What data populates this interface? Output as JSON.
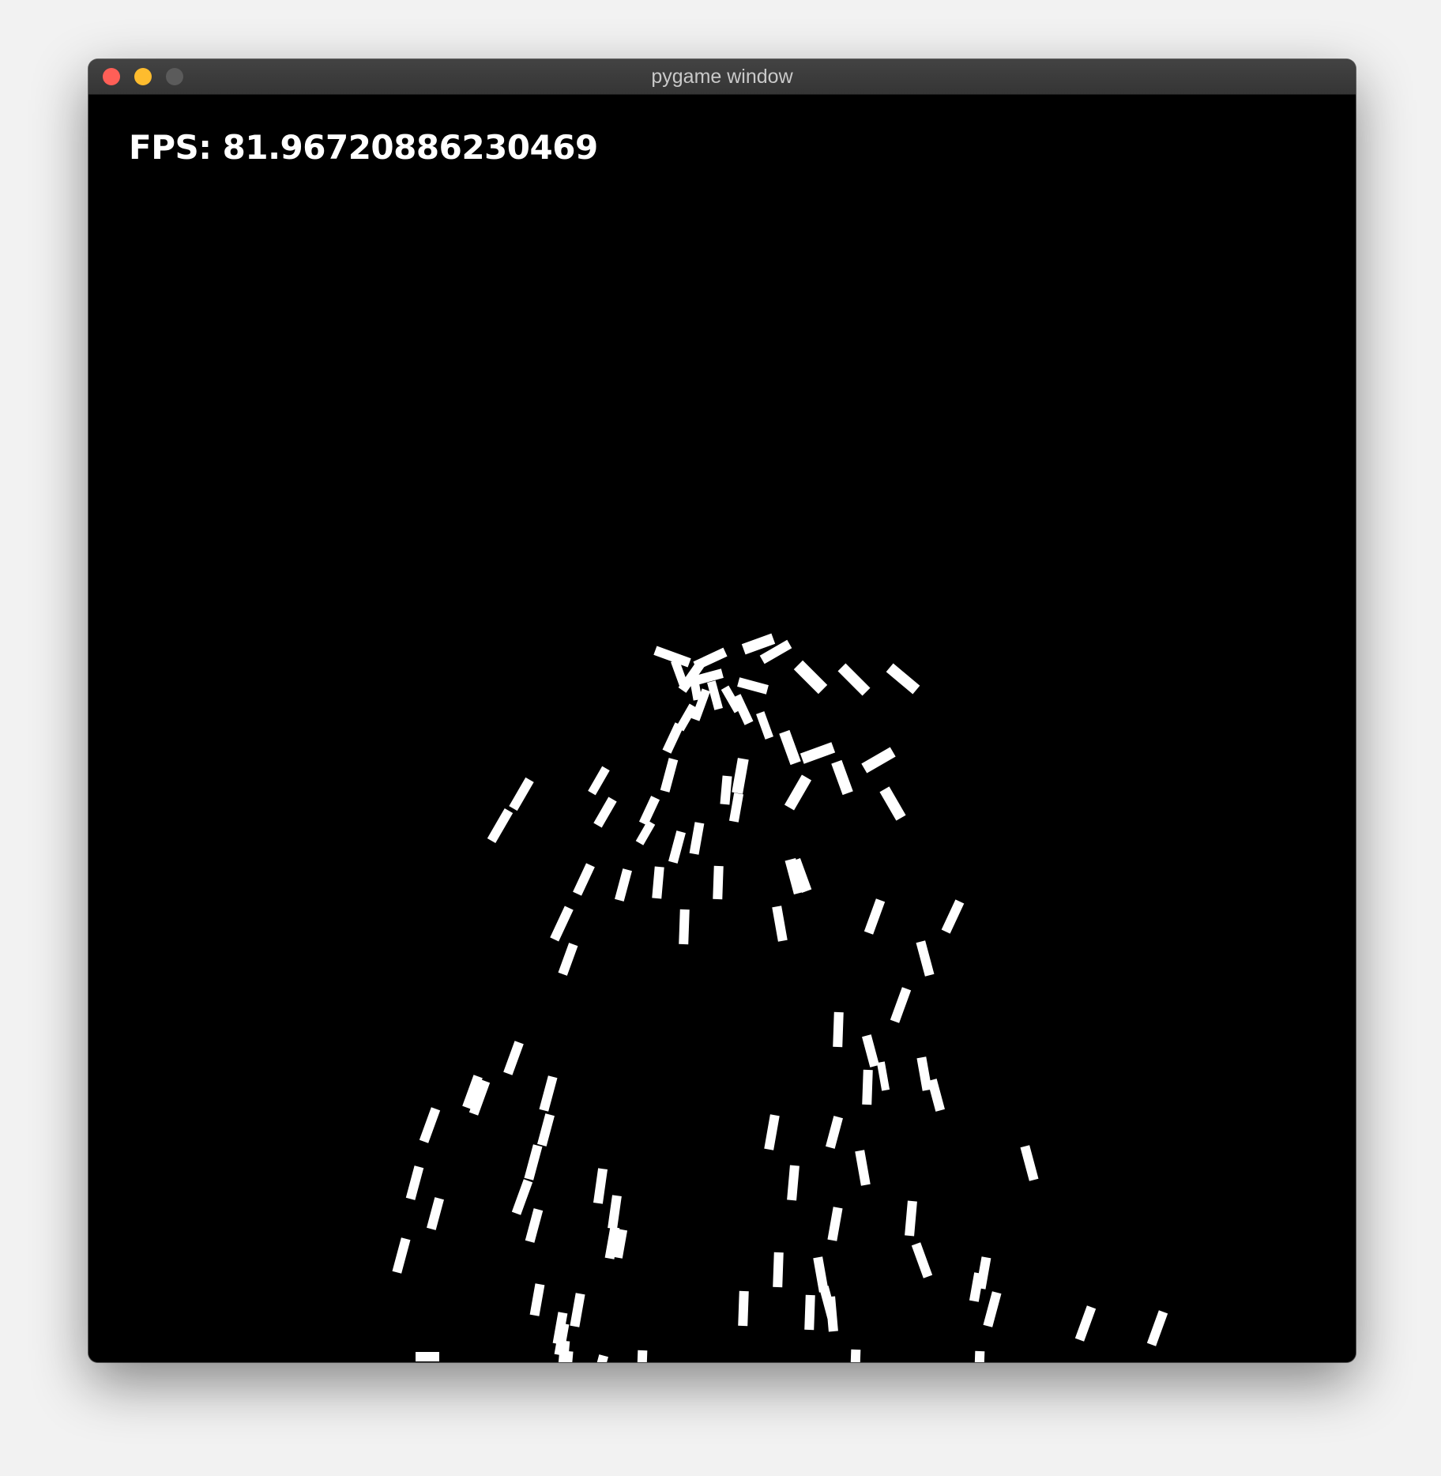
{
  "window": {
    "title": "pygame window"
  },
  "canvas": {
    "background": "#000000",
    "particle_color": "#ffffff"
  },
  "hud": {
    "fps_text": "FPS: 81.96720886230469"
  },
  "colors": {
    "close_button": "#ff5f57",
    "minimize_button": "#febc2e",
    "maximize_button": "#5b5b5b",
    "titlebar": "#3a3a3a"
  }
}
